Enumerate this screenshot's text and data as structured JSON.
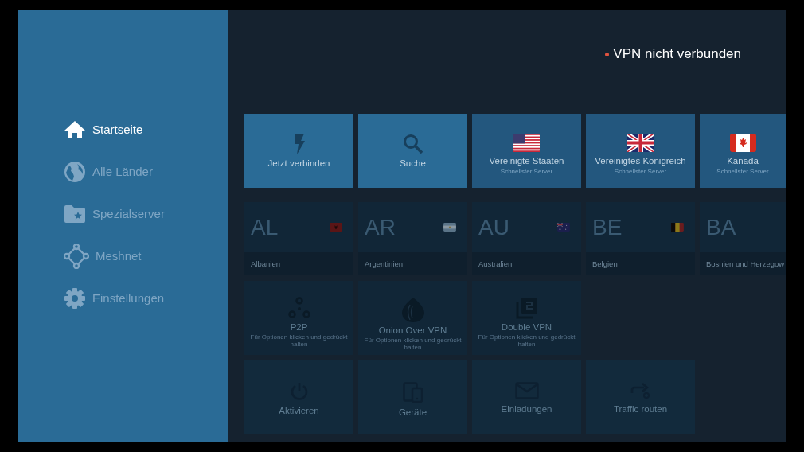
{
  "sidebar": {
    "items": [
      {
        "label": "Startseite",
        "selected": true
      },
      {
        "label": "Alle Länder",
        "selected": false
      },
      {
        "label": "Spezialserver",
        "selected": false
      },
      {
        "label": "Meshnet",
        "selected": false
      },
      {
        "label": "Einstellungen",
        "selected": false
      }
    ]
  },
  "status": {
    "text": "VPN nicht verbunden",
    "connected": false
  },
  "quick_row": [
    {
      "kind": "action",
      "label": "Jetzt verbinden"
    },
    {
      "kind": "action",
      "label": "Suche"
    },
    {
      "kind": "country",
      "label": "Vereinigte Staaten",
      "subtitle": "Schnellster Server"
    },
    {
      "kind": "country",
      "label": "Vereinigtes Königreich",
      "subtitle": "Schnellster Server"
    },
    {
      "kind": "country",
      "label": "Kanada",
      "subtitle": "Schnellster Server"
    }
  ],
  "countries": [
    {
      "code": "AL",
      "name": "Albanien"
    },
    {
      "code": "AR",
      "name": "Argentinien"
    },
    {
      "code": "AU",
      "name": "Australien"
    },
    {
      "code": "BE",
      "name": "Belgien"
    },
    {
      "code": "BA",
      "name": "Bosnien und Herzegow"
    }
  ],
  "specialty": [
    {
      "title": "P2P",
      "hint": "Für Optionen klicken und gedrückt halten"
    },
    {
      "title": "Onion Over VPN",
      "hint": "Für Optionen klicken und gedrückt halten"
    },
    {
      "title": "Double VPN",
      "hint": "Für Optionen klicken und gedrückt halten"
    }
  ],
  "tools": [
    {
      "label": "Aktivieren"
    },
    {
      "label": "Geräte"
    },
    {
      "label": "Einladungen"
    },
    {
      "label": "Traffic routen"
    }
  ]
}
